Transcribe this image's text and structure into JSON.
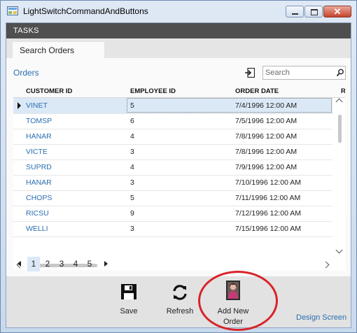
{
  "window": {
    "title": "LightSwitchCommandAndButtons",
    "close_label": "✕"
  },
  "tasks": {
    "label": "TASKS"
  },
  "tab": {
    "label": "Search Orders"
  },
  "orders": {
    "title": "Orders",
    "search_placeholder": "Search",
    "columns": [
      "CUSTOMER ID",
      "EMPLOYEE ID",
      "ORDER DATE",
      "R"
    ],
    "rows": [
      {
        "customer": "VINET",
        "employee": "5",
        "date": "7/4/1996 12:00 AM"
      },
      {
        "customer": "TOMSP",
        "employee": "6",
        "date": "7/5/1996 12:00 AM"
      },
      {
        "customer": "HANAR",
        "employee": "4",
        "date": "7/8/1996 12:00 AM"
      },
      {
        "customer": "VICTE",
        "employee": "3",
        "date": "7/8/1996 12:00 AM"
      },
      {
        "customer": "SUPRD",
        "employee": "4",
        "date": "7/9/1996 12:00 AM"
      },
      {
        "customer": "HANAR",
        "employee": "3",
        "date": "7/10/1996 12:00 AM"
      },
      {
        "customer": "CHOPS",
        "employee": "5",
        "date": "7/11/1996 12:00 AM"
      },
      {
        "customer": "RICSU",
        "employee": "9",
        "date": "7/12/1996 12:00 AM"
      },
      {
        "customer": "WELLI",
        "employee": "3",
        "date": "7/15/1996 12:00 AM"
      }
    ]
  },
  "pager": {
    "pages": [
      "1",
      "2",
      "3",
      "4",
      "5"
    ],
    "current": "1"
  },
  "commands": {
    "save": "Save",
    "refresh": "Refresh",
    "add_new_order_line1": "Add New",
    "add_new_order_line2": "Order"
  },
  "design_screen": "Design Screen",
  "colors": {
    "accent": "#2a6fb0",
    "tasks_bar": "#4f4f4f",
    "selected_row": "#dbe9f7",
    "annotation": "#d8242a"
  }
}
